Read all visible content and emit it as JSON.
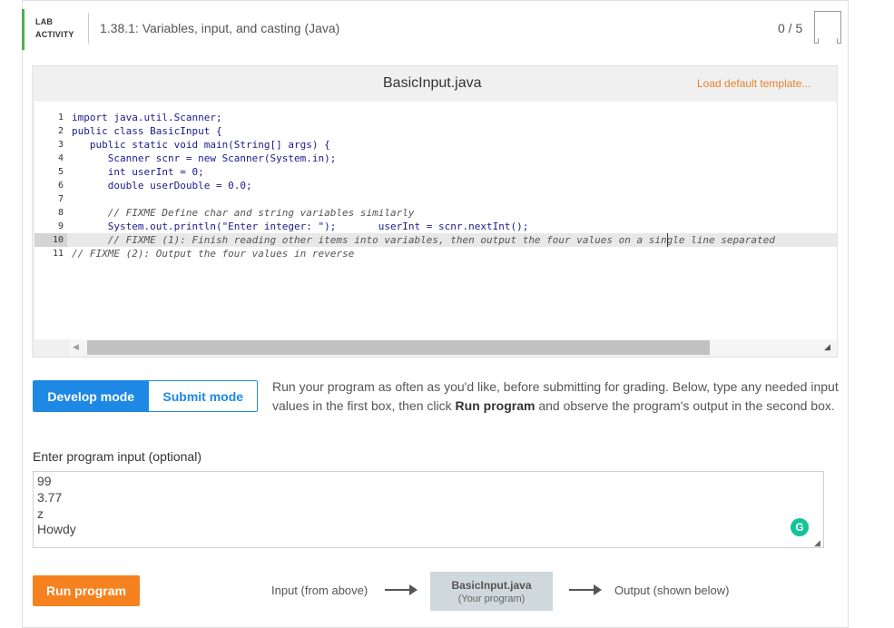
{
  "header": {
    "lab_tag_line1": "LAB",
    "lab_tag_line2": "ACTIVITY",
    "title": "1.38.1: Variables, input, and casting (Java)",
    "score": "0 / 5"
  },
  "editor": {
    "file_name": "BasicInput.java",
    "load_template_label": "Load default template...",
    "lines": [
      {
        "num": "1",
        "text": "import java.util.Scanner;",
        "comment": false
      },
      {
        "num": "2",
        "text": "public class BasicInput {",
        "comment": false
      },
      {
        "num": "3",
        "text": "   public static void main(String[] args) {",
        "comment": false
      },
      {
        "num": "4",
        "text": "      Scanner scnr = new Scanner(System.in);",
        "comment": false
      },
      {
        "num": "5",
        "text": "      int userInt = 0;",
        "comment": false
      },
      {
        "num": "6",
        "text": "      double userDouble = 0.0;",
        "comment": false
      },
      {
        "num": "7",
        "text": "",
        "comment": false
      },
      {
        "num": "8",
        "text": "      // FIXME Define char and string variables similarly",
        "comment": true
      },
      {
        "num": "9",
        "text": "      System.out.println(\"Enter integer: \");       userInt = scnr.nextInt();",
        "comment": false
      },
      {
        "num": "10",
        "text": "      // FIXME (1): Finish reading other items into variables, then output the four values on a single line separated",
        "comment": true
      },
      {
        "num": "11",
        "text": "// FIXME (2): Output the four values in reverse",
        "comment": true
      }
    ],
    "scroll_left_icon": "triangle-left-icon",
    "scroll_right_icon": "triangle-right-icon"
  },
  "modes": {
    "develop_label": "Develop mode",
    "submit_label": "Submit mode",
    "active": "develop",
    "active_color": "#1e88e5"
  },
  "instructions": {
    "part1": "Run your program as often as you'd like, before submitting for grading. Below, type any needed input values in the first box, then click ",
    "bold": "Run program",
    "part2": " and observe the program's output in the second box."
  },
  "input": {
    "label": "Enter program input (optional)",
    "lines": [
      "99",
      "3.77",
      "z",
      "Howdy"
    ],
    "grammarly_letter": "G"
  },
  "run": {
    "button_label": "Run program",
    "button_color": "#f5821f",
    "input_from_label": "Input (from above)",
    "program_name": "BasicInput.java",
    "program_sub": "(Your program)",
    "output_label": "Output (shown below)"
  }
}
